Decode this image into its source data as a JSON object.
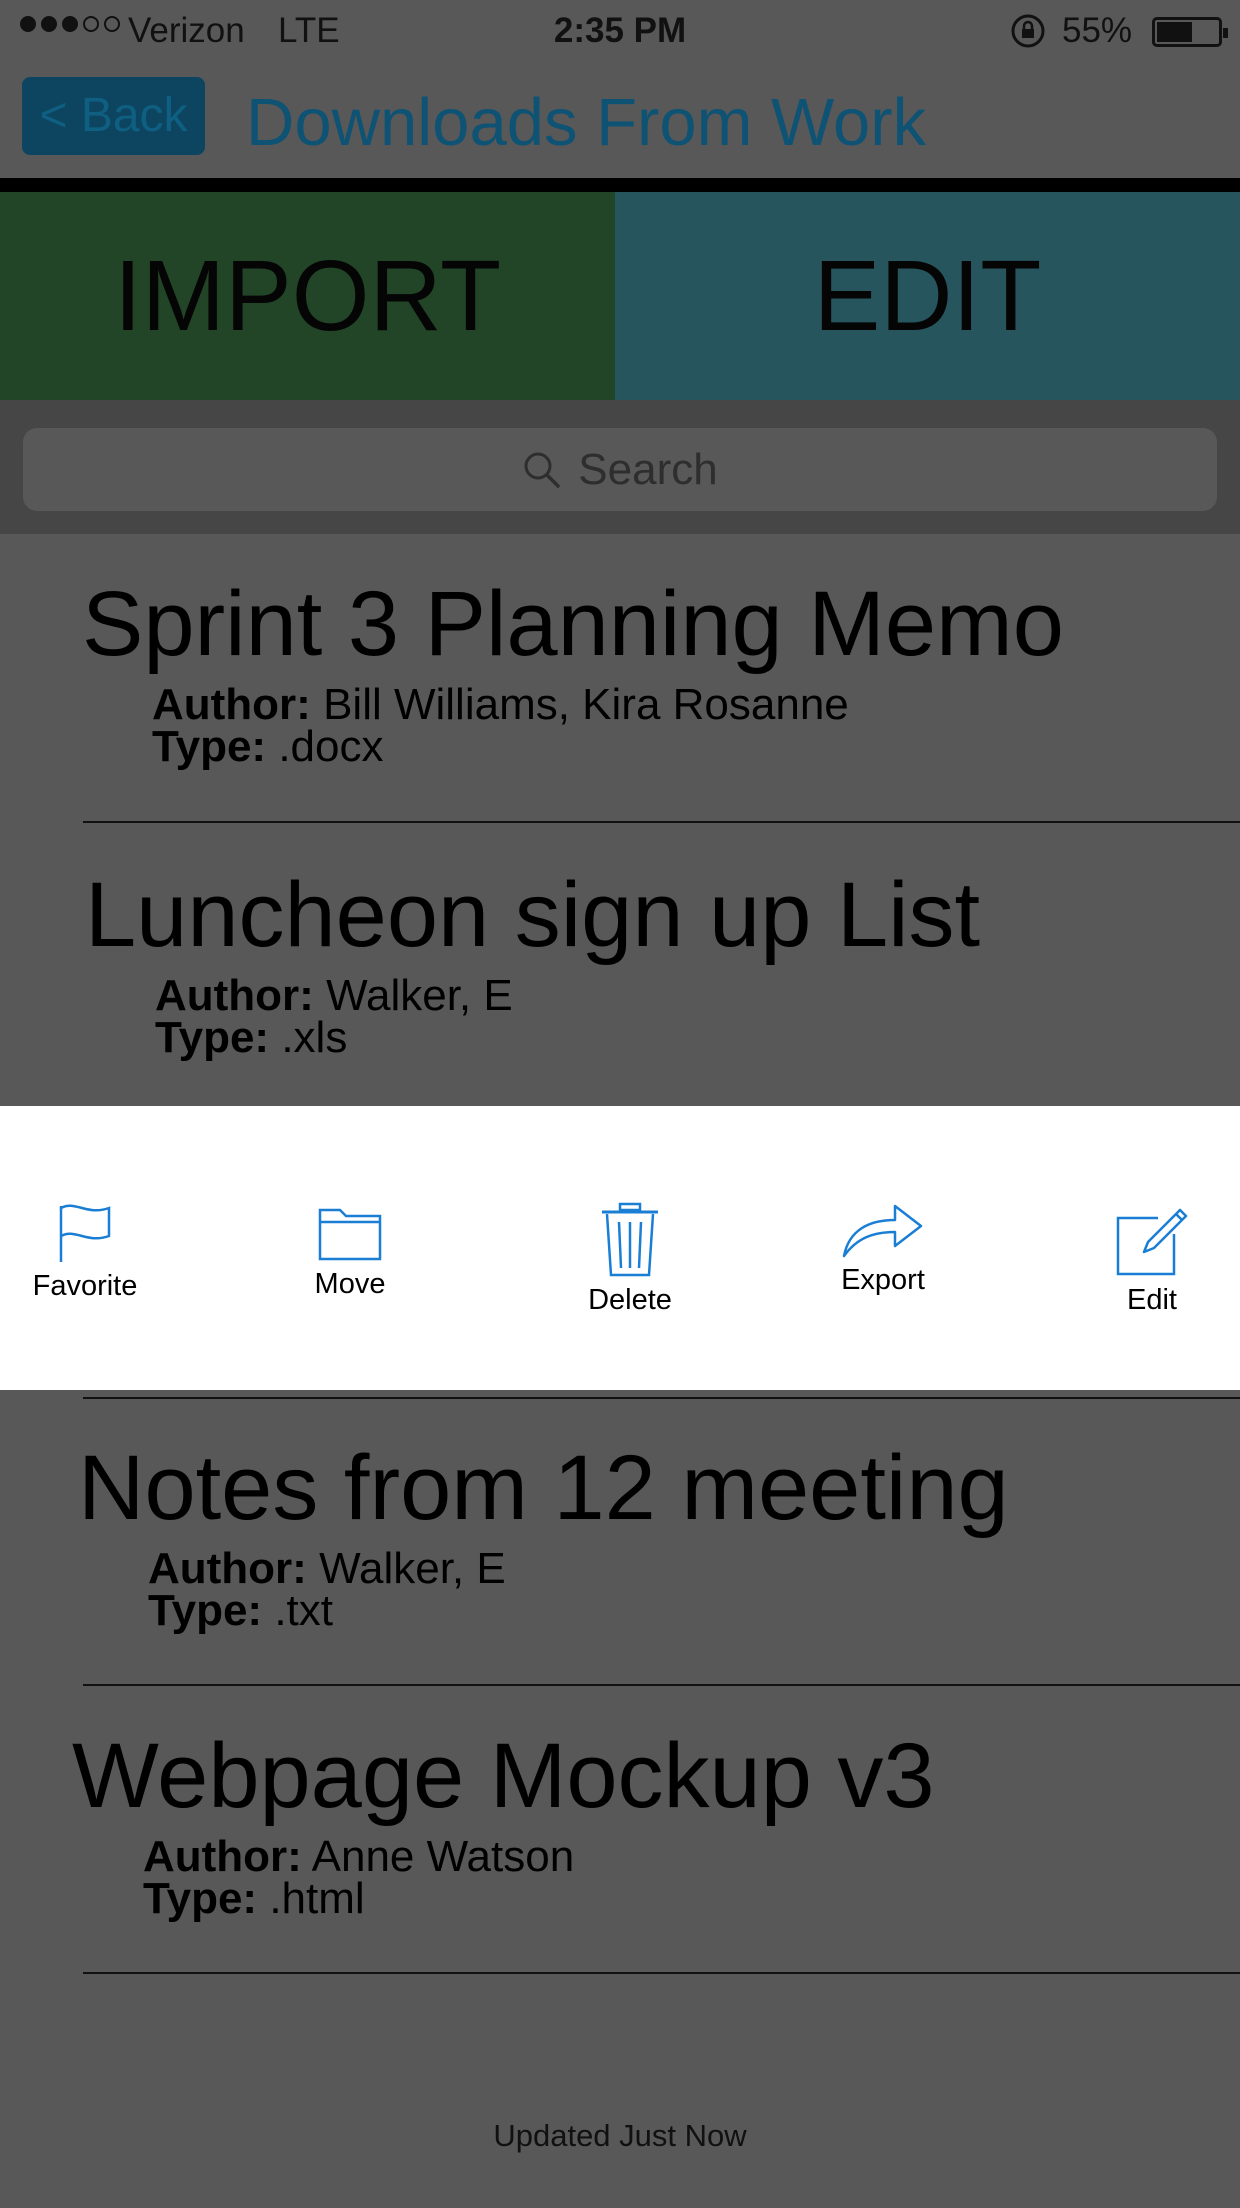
{
  "status_bar": {
    "carrier": "Verizon",
    "network": "LTE",
    "time": "2:35 PM",
    "battery": "55%",
    "signal_bars": 3
  },
  "nav": {
    "back_label": "< Back",
    "title": "Downloads From Work"
  },
  "buttons": {
    "import": "IMPORT",
    "edit": "EDIT"
  },
  "search": {
    "placeholder": "Search"
  },
  "files": [
    {
      "title": "Sprint 3 Planning Memo",
      "author_label": "Author:",
      "author": "Bill Williams, Kira Rosanne",
      "type_label": "Type:",
      "type": ".docx"
    },
    {
      "title": "Luncheon sign up List",
      "author_label": "Author:",
      "author": "Walker, E",
      "type_label": "Type:",
      "type": ".xls"
    },
    {
      "title": "Notes from 12 meeting",
      "author_label": "Author:",
      "author": "Walker, E",
      "type_label": "Type:",
      "type": ".txt"
    },
    {
      "title": "Webpage Mockup v3",
      "author_label": "Author:",
      "author": "Anne Watson",
      "type_label": "Type:",
      "type": ".html"
    }
  ],
  "actions": [
    {
      "label": "Favorite",
      "icon": "flag-icon"
    },
    {
      "label": "Move",
      "icon": "folder-icon"
    },
    {
      "label": "Delete",
      "icon": "trash-icon"
    },
    {
      "label": "Export",
      "icon": "share-arrow-icon"
    },
    {
      "label": "Edit",
      "icon": "compose-icon"
    }
  ],
  "footer": {
    "status": "Updated Just Now"
  },
  "colors": {
    "import_bg": "#224427",
    "edit_bg": "#26555d",
    "accent": "#1a7fd4",
    "dim_overlay": "#585858"
  }
}
